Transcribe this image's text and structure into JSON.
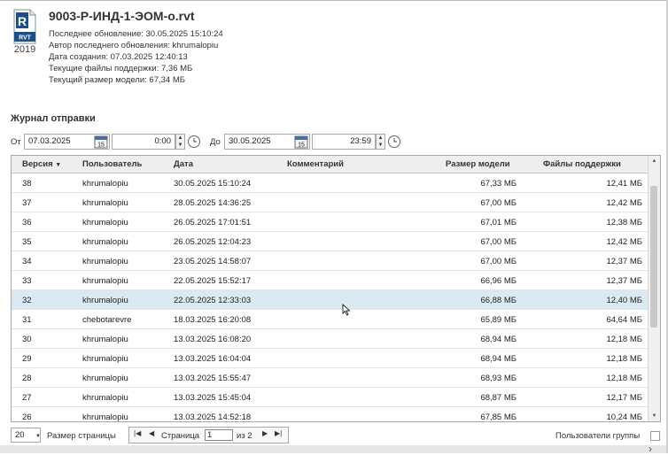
{
  "file": {
    "title": "9003-Р-ИНД-1-ЭОМ-о.rvt",
    "badge_text": "RVT",
    "year": "2019",
    "last_update": "Последнее обновление: 30.05.2025 15:10:24",
    "last_update_author": "Автор последнего обновления: khrumalopiu",
    "created": "Дата создания: 07.03.2025 12:40:13",
    "support_size": "Текущие файлы поддержки: 7,36 МБ",
    "model_size": "Текущий размер модели: 67,34 МБ"
  },
  "journal": {
    "title": "Журнал отправки",
    "from_label": "От",
    "from_date": "07.03.2025",
    "from_time": "0:00",
    "to_label": "До",
    "to_date": "30.05.2025",
    "to_time": "23:59",
    "calendar_day": "15"
  },
  "table": {
    "columns": {
      "version": "Версия",
      "user": "Пользователь",
      "date": "Дата",
      "comment": "Комментарий",
      "model_size": "Размер модели",
      "support_files": "Файлы поддержки"
    },
    "sort_indicator": "▼",
    "rows": [
      {
        "version": "38",
        "user": "khrumalopiu",
        "date": "30.05.2025 15:10:24",
        "model_size": "67,33 МБ",
        "support": "12,41 МБ"
      },
      {
        "version": "37",
        "user": "khrumalopiu",
        "date": "28.05.2025 14:36:25",
        "model_size": "67,00 МБ",
        "support": "12,42 МБ"
      },
      {
        "version": "36",
        "user": "khrumalopiu",
        "date": "26.05.2025 17:01:51",
        "model_size": "67,01 МБ",
        "support": "12,38 МБ"
      },
      {
        "version": "35",
        "user": "khrumalopiu",
        "date": "26.05.2025 12:04:23",
        "model_size": "67,00 МБ",
        "support": "12,42 МБ"
      },
      {
        "version": "34",
        "user": "khrumalopiu",
        "date": "23.05.2025 14:58:07",
        "model_size": "67,00 МБ",
        "support": "12,37 МБ"
      },
      {
        "version": "33",
        "user": "khrumalopiu",
        "date": "22.05.2025 15:52:17",
        "model_size": "66,96 МБ",
        "support": "12,37 МБ"
      },
      {
        "version": "32",
        "user": "khrumalopiu",
        "date": "22.05.2025 12:33:03",
        "model_size": "66,88 МБ",
        "support": "12,40 МБ"
      },
      {
        "version": "31",
        "user": "chebotarevre",
        "date": "18.03.2025 16:20:08",
        "model_size": "65,89 МБ",
        "support": "64,64 МБ"
      },
      {
        "version": "30",
        "user": "khrumalopiu",
        "date": "13.03.2025 16:08:20",
        "model_size": "68,94 МБ",
        "support": "12,18 МБ"
      },
      {
        "version": "29",
        "user": "khrumalopiu",
        "date": "13.03.2025 16:04:04",
        "model_size": "68,94 МБ",
        "support": "12,18 МБ"
      },
      {
        "version": "28",
        "user": "khrumalopiu",
        "date": "13.03.2025 15:55:47",
        "model_size": "68,93 МБ",
        "support": "12,18 МБ"
      },
      {
        "version": "27",
        "user": "khrumalopiu",
        "date": "13.03.2025 15:45:04",
        "model_size": "68,87 МБ",
        "support": "12,17 МБ"
      },
      {
        "version": "26",
        "user": "khrumalopiu",
        "date": "13.03.2025 14:52:18",
        "model_size": "67,85 МБ",
        "support": "10,24 МБ"
      }
    ],
    "selected_version": "32"
  },
  "pager": {
    "page_size": "20",
    "page_size_label": "Размер страницы",
    "page_label": "Страница",
    "current_page": "1",
    "of_label": "из 2",
    "group_users_label": "Пользователи группы"
  },
  "colors": {
    "selected_row": "#dbeaf2",
    "header_bg": "#eeeeee",
    "rvt_blue": "#1b4f8a"
  }
}
